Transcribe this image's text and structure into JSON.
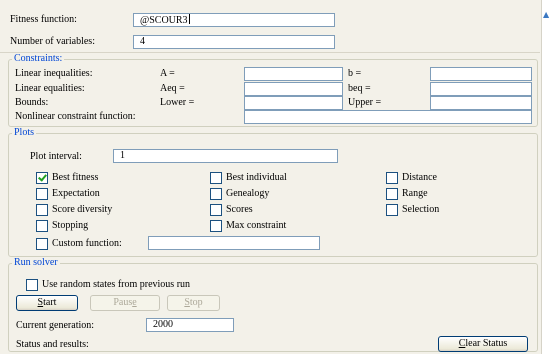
{
  "problem": {
    "fitness_label": "Fitness function:",
    "fitness_value": "@SCOUR3",
    "nvars_label": "Number of variables:",
    "nvars_value": "4"
  },
  "constraints": {
    "title": "Constraints:",
    "linear_ineq_label": "Linear inequalities:",
    "A_label": "A =",
    "b_label": "b =",
    "linear_eq_label": "Linear equalities:",
    "Aeq_label": "Aeq =",
    "beq_label": "beq =",
    "bounds_label": "Bounds:",
    "lower_label": "Lower =",
    "upper_label": "Upper =",
    "nonlinear_label": "Nonlinear constraint function:"
  },
  "plots": {
    "title": "Plots",
    "interval_label": "Plot interval:",
    "interval_value": "1",
    "options": [
      {
        "label": "Best fitness",
        "checked": true
      },
      {
        "label": "Best individual",
        "checked": false
      },
      {
        "label": "Distance",
        "checked": false
      },
      {
        "label": "Expectation",
        "checked": false
      },
      {
        "label": "Genealogy",
        "checked": false
      },
      {
        "label": "Range",
        "checked": false
      },
      {
        "label": "Score diversity",
        "checked": false
      },
      {
        "label": "Scores",
        "checked": false
      },
      {
        "label": "Selection",
        "checked": false
      },
      {
        "label": "Stopping",
        "checked": false
      },
      {
        "label": "Max constraint",
        "checked": false
      }
    ],
    "custom_label": "Custom function:"
  },
  "run": {
    "title": "Run solver",
    "random_states_label": "Use random states from previous run",
    "start_u": "S",
    "start_rest": "tart",
    "pause_pre": "Paus",
    "pause_u": "e",
    "stop_u": "S",
    "stop_rest": "top",
    "current_gen_label": "Current generation:",
    "current_gen_value": "2000",
    "status_label": "Status and results:",
    "clear_u": "C",
    "clear_rest": "lear Status"
  },
  "colors": {
    "panel_bg": "#f3f1e9",
    "group_title": "#0046d5",
    "field_border": "#7f9db9",
    "check_mark": "#21a121"
  }
}
